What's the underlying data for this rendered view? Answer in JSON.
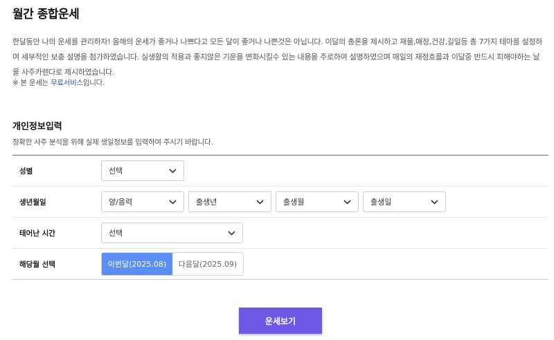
{
  "header": {
    "title": "월간 종합운세"
  },
  "intro": {
    "text": "한달동안 나의 운세를 관리하자! 올해의 운세가 좋거나 나쁘다고 모든 달이 좋거나 나쁜것은 아닙니다. 이달의 총론을 제시하고 재물,애정,건강,길일등 총 7가지 테마를 설정하여 세부적인 보충 설명을 첨가하였습니다. 실생활의 적용과 좋지않은 기운을 변화시킬수 있는 내용을 주로하여 설명하였으며 매일의 재정흐름과 이달중 반드시 피해야하는 날을 사주카렌다로 제시하였습니다.",
    "note_prefix": "※ 본 운세는 ",
    "note_link": "무료서비스",
    "note_suffix": "입니다."
  },
  "section": {
    "title": "개인정보입력",
    "description": "정확한 사주 분석을 위해 실제 생일정보를 입력하여 주시기 바랍니다."
  },
  "form": {
    "gender": {
      "label": "성별",
      "value": "선택"
    },
    "birth": {
      "label": "생년월일",
      "calendar": "양/음력",
      "year": "출생년",
      "month": "출생월",
      "day": "출생일"
    },
    "time": {
      "label": "태어난 시간",
      "value": "선택"
    },
    "month_select": {
      "label": "해당월 선택",
      "options": [
        "이번달(2025.08)",
        "다음달(2025.09)"
      ],
      "selected": "이번달(2025.08)"
    }
  },
  "submit": {
    "label": "운세보기"
  },
  "colors": {
    "accent": "#6c5ae6",
    "tab_active": "#5b8ef6",
    "link": "#3b55b8"
  },
  "icons": {
    "dropdown": "chevron-down-icon"
  }
}
